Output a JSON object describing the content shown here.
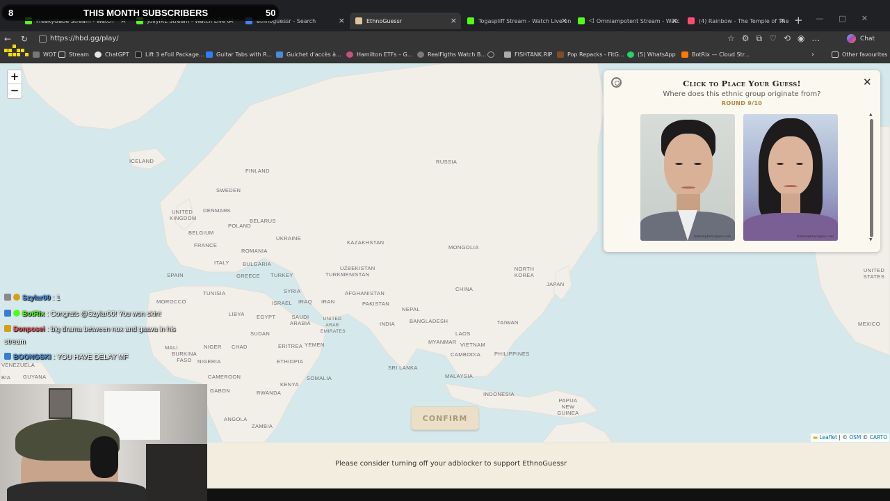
{
  "overlay": {
    "subs_left": "8",
    "subs_title": "THIS MONTH SUBSCRIBERS",
    "subs_right": "50"
  },
  "tabs": [
    {
      "label": "FreakyGabe Stream - Watch",
      "color": "#53fc18"
    },
    {
      "label": "JollyIRL Stream - Watch Live o",
      "color": "#53fc18"
    },
    {
      "label": "ethnoguessr - Search",
      "color": "#3b82f6"
    },
    {
      "label": "EthnoGuessr",
      "color": "#e0c59a"
    },
    {
      "label": "Togaspliff Stream - Watch Live on",
      "color": "#53fc18"
    },
    {
      "label": "Omniampotent Stream - Watc",
      "color": "#53fc18"
    },
    {
      "label": "(4) Rainbow - The Temple of The",
      "color": "#ff4d6d"
    }
  ],
  "address": {
    "url": "https://hbd.gg/play/"
  },
  "toolbar": {
    "chat_label": "Chat"
  },
  "bookmarks": [
    {
      "label": "WOT",
      "color": "#777777"
    },
    {
      "label": "Stream",
      "color": "#d9d9d9"
    },
    {
      "label": "ChatGPT",
      "color": "#e5e5e5"
    },
    {
      "label": "Lift 3 eFoil Package...",
      "color": "#222222"
    },
    {
      "label": "Guitar Tabs with R...",
      "color": "#2d7ff9"
    },
    {
      "label": "Guichet d'accès à...",
      "color": "#4a8bd8"
    },
    {
      "label": "Hamilton ETFs – G...",
      "color": "#c94f7c"
    },
    {
      "label": "RealFigths Watch B...",
      "color": "#7a7a7a"
    },
    {
      "label": "FISHTANK.RIP",
      "color": "#aaaaaa"
    },
    {
      "label": "Pop Repacks - FitG...",
      "color": "#7b4f2c"
    },
    {
      "label": "(5) WhatsApp",
      "color": "#25d366"
    },
    {
      "label": "BotRix — Cloud Str...",
      "color": "#ff7a00"
    }
  ],
  "bookmarks_other": "Other favourites",
  "map": {
    "labels": [
      "ICELAND",
      "FINLAND",
      "SWEDEN",
      "UNITED KINGDOM",
      "DENMARK",
      "POLAND",
      "BELARUS",
      "BELGIUM",
      "FRANCE",
      "ROMANIA",
      "UKRAINE",
      "ITALY",
      "BULGARIA",
      "SPAIN",
      "GREECE",
      "TURKEY",
      "TUNISIA",
      "MOROCCO",
      "LIBYA",
      "EGYPT",
      "ISRAEL",
      "SYRIA",
      "IRAQ",
      "IRAN",
      "SAUDI ARABIA",
      "UNITED ARAB EMIRATES",
      "YEMEN",
      "SUDAN",
      "CHAD",
      "NIGER",
      "MALI",
      "BURKINA FASO",
      "NIGERIA",
      "ERITREA",
      "ETHIOPIA",
      "CAMEROON",
      "GABON",
      "KENYA",
      "RWANDA",
      "ANGOLA",
      "ZAMBIA",
      "SOMALIA",
      "RUSSIA",
      "KAZAKHSTAN",
      "UZBEKISTAN",
      "TURKMENISTAN",
      "AFGHANISTAN",
      "PAKISTAN",
      "INDIA",
      "NEPAL",
      "BANGLADESH",
      "MONGOLIA",
      "CHINA",
      "NORTH KOREA",
      "JAPAN",
      "TAIWAN",
      "MYANMAR",
      "LAOS",
      "VIETNAM",
      "CAMBODIA",
      "PHILIPPINES",
      "MALAYSIA",
      "INDONESIA",
      "PAPUA NEW GUINEA",
      "SRI LANKA",
      "UNITED STATES",
      "MEXICO",
      "VENEZUELA",
      "GUYANA",
      "BIA"
    ],
    "zoom_in": "+",
    "zoom_out": "−"
  },
  "panel": {
    "title": "Click to Place Your Guess!",
    "subtitle": "Where does this ethnic group originate from?",
    "round": "ROUND 9/10",
    "male_watermark": "humanphenotypes.com",
    "female_watermark": "humanphenotypes.com",
    "close": "✕"
  },
  "confirm_label": "CONFIRM",
  "attribution": {
    "leaflet": "Leaflet",
    "sep": " | © ",
    "osm": "OSM",
    "sep2": " © ",
    "carto": "CARTO"
  },
  "ad_message": "Please consider turning off your adblocker to support EthnoGuessr",
  "chat": [
    {
      "user": "Szylar00",
      "msg": ": 1",
      "user_color": "#4a90e2",
      "badge": "#d4a017"
    },
    {
      "user": "BotRix",
      "msg": ": Congrats @Szylar00! You won skin!",
      "user_color": "#53fc18",
      "badge": "#3a7bd5"
    },
    {
      "user": "Donposei",
      "msg": ": big drama between nox and gaava in his",
      "msg2": "stream",
      "user_color": "#ff5a5a",
      "badge": "#d4a017"
    },
    {
      "user": "BOONGSKI",
      "msg": ": YOU HAVE DELAY MF",
      "user_color": "#4a90e2",
      "badge": "#3a7bd5"
    }
  ],
  "colors": {
    "water": "#d5e8eb",
    "land": "#f2efe9",
    "panel_bg": "#fbf8ef",
    "round_color": "#b0853a",
    "confirm_bg": "#ebe0c7"
  }
}
